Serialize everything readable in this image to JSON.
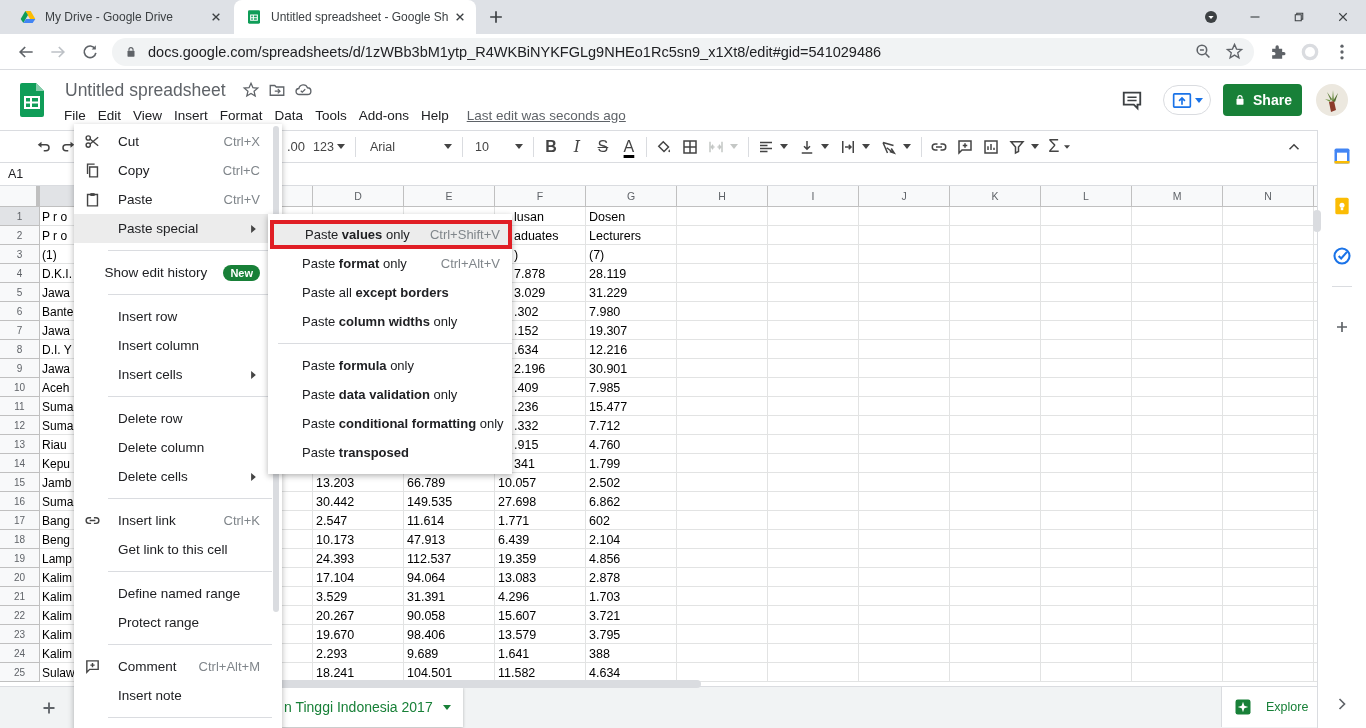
{
  "browser": {
    "tabs": [
      {
        "title": "My Drive - Google Drive",
        "selected": false
      },
      {
        "title": "Untitled spreadsheet - Google Sh",
        "selected": true
      }
    ],
    "url": "docs.google.com/spreadsheets/d/1zWBb3bM1ytp_R4WKBiNYKFGLg9NHEo1Rc5sn9_x1Xt8/edit#gid=541029486"
  },
  "doc": {
    "title": "Untitled spreadsheet",
    "menus": [
      "File",
      "Edit",
      "View",
      "Insert",
      "Format",
      "Data",
      "Tools",
      "Add-ons",
      "Help"
    ],
    "last_edit": "Last edit was seconds ago",
    "share_label": "Share"
  },
  "toolbar": {
    "decimal": ".00",
    "number_format": "123",
    "font": "Arial",
    "font_size": "10",
    "text_styles": [
      {
        "label": "B",
        "kind": "bold"
      },
      {
        "label": "I",
        "kind": "italic"
      },
      {
        "label": "S",
        "kind": "strike"
      },
      {
        "label": "A",
        "kind": "color"
      }
    ],
    "merge": {
      "disabled": true
    },
    "function_label": "Σ"
  },
  "name_box": "A1",
  "columns": [
    "D",
    "E",
    "F",
    "G",
    "H",
    "I",
    "J",
    "K",
    "L",
    "M",
    "N"
  ],
  "rows": [
    {
      "number": "1",
      "cells": {
        "A": "P r o",
        "F": "lusan",
        "G": "Dosen"
      }
    },
    {
      "number": "2",
      "cells": {
        "A": "P r o",
        "F": "aduates",
        "G": "Lecturers"
      }
    },
    {
      "number": "3",
      "cells": {
        "A": "(1)",
        "F": ")",
        "G": "(7)"
      }
    },
    {
      "number": "4",
      "cells": {
        "A": "D.K.I.",
        "F": "7.878",
        "G": "28.119"
      }
    },
    {
      "number": "5",
      "cells": {
        "A": "Jawa",
        "F": "3.029",
        "G": "31.229"
      }
    },
    {
      "number": "6",
      "cells": {
        "A": "Bante",
        "F": ".302",
        "G": "7.980"
      }
    },
    {
      "number": "7",
      "cells": {
        "A": "Jawa",
        "F": ".152",
        "G": "19.307"
      }
    },
    {
      "number": "8",
      "cells": {
        "A": "D.I. Y",
        "F": ".634",
        "G": "12.216"
      }
    },
    {
      "number": "9",
      "cells": {
        "A": "Jawa",
        "F": "2.196",
        "G": "30.901"
      }
    },
    {
      "number": "10",
      "cells": {
        "A": "Aceh",
        "F": ".409",
        "G": "7.985"
      }
    },
    {
      "number": "11",
      "cells": {
        "A": "Suma",
        "F": ".236",
        "G": "15.477"
      }
    },
    {
      "number": "12",
      "cells": {
        "A": "Suma",
        "F": ".332",
        "G": "7.712"
      }
    },
    {
      "number": "13",
      "cells": {
        "A": "Riau",
        "F": ".915",
        "G": "4.760"
      }
    },
    {
      "number": "14",
      "cells": {
        "A": "Kepu",
        "F": "341",
        "G": "1.799"
      }
    },
    {
      "number": "15",
      "cells": {
        "A": "Jamb",
        "D": "13.203",
        "E": "66.789",
        "F": "10.057",
        "G": "2.502"
      }
    },
    {
      "number": "16",
      "cells": {
        "A": "Suma",
        "D": "30.442",
        "E": "149.535",
        "F": "27.698",
        "G": "6.862"
      }
    },
    {
      "number": "17",
      "cells": {
        "A": "Bang",
        "D": "2.547",
        "E": "11.614",
        "F": "1.771",
        "G": "602"
      }
    },
    {
      "number": "18",
      "cells": {
        "A": "Beng",
        "D": "10.173",
        "E": "47.913",
        "F": "6.439",
        "G": "2.104"
      }
    },
    {
      "number": "19",
      "cells": {
        "A": "Lamp",
        "D": "24.393",
        "E": "112.537",
        "F": "19.359",
        "G": "4.856"
      }
    },
    {
      "number": "20",
      "cells": {
        "A": "Kalim",
        "D": "17.104",
        "E": "94.064",
        "F": "13.083",
        "G": "2.878"
      }
    },
    {
      "number": "21",
      "cells": {
        "A": "Kalim",
        "D": "3.529",
        "E": "31.391",
        "F": "4.296",
        "G": "1.703"
      }
    },
    {
      "number": "22",
      "cells": {
        "A": "Kalim",
        "D": "20.267",
        "E": "90.058",
        "F": "15.607",
        "G": "3.721"
      }
    },
    {
      "number": "23",
      "cells": {
        "A": "Kalim",
        "D": "19.670",
        "E": "98.406",
        "F": "13.579",
        "G": "3.795"
      }
    },
    {
      "number": "24",
      "cells": {
        "A": "Kalim",
        "D": "2.293",
        "E": "9.689",
        "F": "1.641",
        "G": "388"
      }
    },
    {
      "number": "25",
      "cells": {
        "A": "Sulaw",
        "D": "18.241",
        "E": "104.501",
        "F": "11.582",
        "G": "4.634"
      }
    }
  ],
  "sheet_tab": {
    "label": "n Tinggi Indonesia 2017",
    "selected": true
  },
  "explore_label": "Explore",
  "edit_menu": [
    {
      "kind": "item",
      "label": "Cut",
      "shortcut": "Ctrl+X",
      "has_submenu": false,
      "selected": false
    },
    {
      "kind": "item",
      "label": "Copy",
      "shortcut": "Ctrl+C",
      "has_submenu": false,
      "selected": false
    },
    {
      "kind": "item",
      "label": "Paste",
      "shortcut": "Ctrl+V",
      "has_submenu": false,
      "selected": false
    },
    {
      "kind": "item",
      "label": "Paste special",
      "has_submenu": true,
      "selected": true
    },
    {
      "kind": "divider"
    },
    {
      "kind": "item",
      "label": "Show edit history",
      "badge": "New",
      "has_submenu": false,
      "selected": false
    },
    {
      "kind": "divider"
    },
    {
      "kind": "item",
      "label": "Insert row",
      "has_submenu": false,
      "selected": false
    },
    {
      "kind": "item",
      "label": "Insert column",
      "has_submenu": false,
      "selected": false
    },
    {
      "kind": "item",
      "label": "Insert cells",
      "has_submenu": true,
      "selected": false
    },
    {
      "kind": "divider"
    },
    {
      "kind": "item",
      "label": "Delete row",
      "has_submenu": false,
      "selected": false
    },
    {
      "kind": "item",
      "label": "Delete column",
      "has_submenu": false,
      "selected": false
    },
    {
      "kind": "item",
      "label": "Delete cells",
      "has_submenu": true,
      "selected": false
    },
    {
      "kind": "divider"
    },
    {
      "kind": "item",
      "label": "Insert link",
      "shortcut": "Ctrl+K",
      "has_submenu": false,
      "selected": false
    },
    {
      "kind": "item",
      "label": "Get link to this cell",
      "has_submenu": false,
      "selected": false
    },
    {
      "kind": "divider"
    },
    {
      "kind": "item",
      "label": "Define named range",
      "has_submenu": false,
      "selected": false
    },
    {
      "kind": "item",
      "label": "Protect range",
      "has_submenu": false,
      "selected": false
    },
    {
      "kind": "divider"
    },
    {
      "kind": "item",
      "label": "Comment",
      "shortcut": "Ctrl+Alt+M",
      "has_submenu": false,
      "selected": false
    },
    {
      "kind": "item",
      "label": "Insert note",
      "has_submenu": false,
      "selected": false
    },
    {
      "kind": "divider"
    }
  ],
  "paste_special_menu": [
    {
      "kind": "item",
      "label": "Paste **values** only",
      "shortcut": "Ctrl+Shift+V",
      "selected": true
    },
    {
      "kind": "item",
      "label": "Paste **format** only",
      "shortcut": "Ctrl+Alt+V",
      "selected": false
    },
    {
      "kind": "item",
      "label": "Paste all **except borders**",
      "selected": false
    },
    {
      "kind": "item",
      "label": "Paste **column widths** only",
      "selected": false
    },
    {
      "kind": "divider"
    },
    {
      "kind": "item",
      "label": "Paste **formula** only",
      "selected": false
    },
    {
      "kind": "item",
      "label": "Paste **data validation** only",
      "selected": false
    },
    {
      "kind": "item",
      "label": "Paste **conditional formatting** only",
      "selected": false
    },
    {
      "kind": "item",
      "label": "Paste **transposed**",
      "selected": false
    }
  ]
}
